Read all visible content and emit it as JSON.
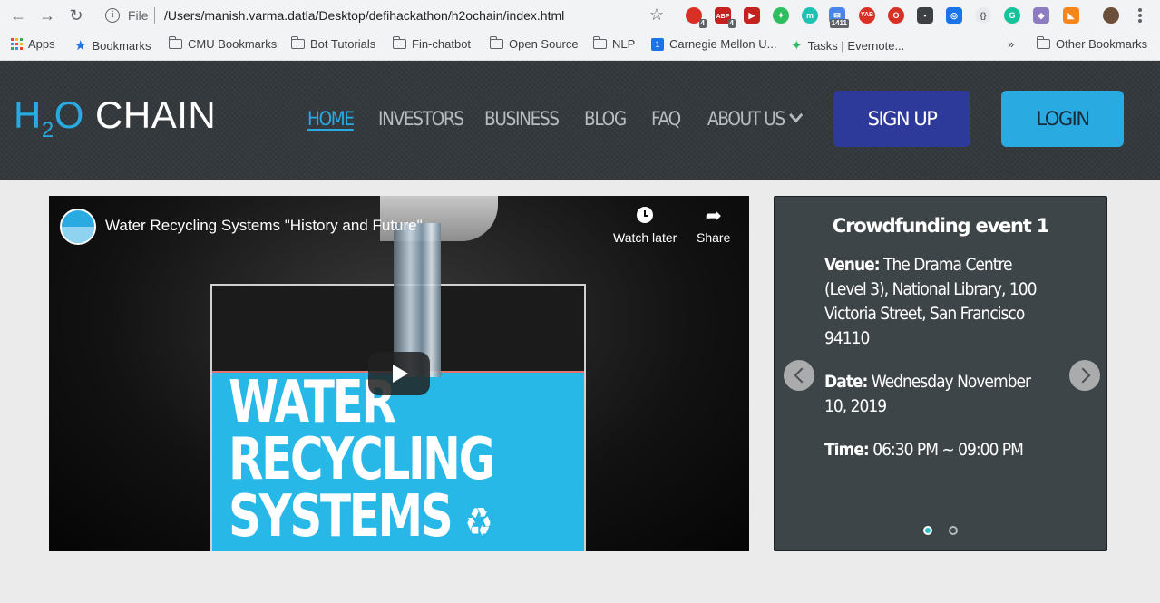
{
  "browser": {
    "address": {
      "scheme_label": "File",
      "url": "/Users/manish.varma.datla/Desktop/defihackathon/h2ochain/index.html"
    },
    "extension_badges": {
      "ext1": "4",
      "ext2": "4",
      "mail": "1411",
      "yab": "YAB",
      "abp": "ABP"
    },
    "bookmarks": [
      {
        "label": "Apps",
        "icon": "apps-grid-icon"
      },
      {
        "label": "Bookmarks",
        "icon": "star-icon"
      },
      {
        "label": "CMU Bookmarks",
        "icon": "folder-icon"
      },
      {
        "label": "Bot Tutorials",
        "icon": "folder-icon"
      },
      {
        "label": "Fin-chatbot",
        "icon": "folder-icon"
      },
      {
        "label": "Open Source",
        "icon": "folder-icon"
      },
      {
        "label": "NLP",
        "icon": "folder-icon"
      },
      {
        "label": "Carnegie Mellon U...",
        "icon": "calendar-icon"
      },
      {
        "label": "Tasks | Evernote...",
        "icon": "evernote-icon"
      }
    ],
    "overflow": "»",
    "other_bookmarks": "Other Bookmarks"
  },
  "site": {
    "logo": {
      "part1": "H",
      "sub": "2",
      "part2": "O",
      "part3": " CHAIN"
    },
    "nav": [
      {
        "label": "HOME",
        "active": true
      },
      {
        "label": "INVESTORS"
      },
      {
        "label": "BUSINESS"
      },
      {
        "label": "BLOG"
      },
      {
        "label": "FAQ"
      },
      {
        "label": "ABOUT US",
        "dropdown": true
      }
    ],
    "signup_label": "SIGN UP",
    "login_label": "LOGIN",
    "colors": {
      "accent": "#29aae1",
      "signup": "#2e3a9a",
      "header": "#34393d"
    }
  },
  "video": {
    "title": "Water Recycling Systems \"History and Future\"",
    "watch_later": "Watch later",
    "share": "Share",
    "thumbnail_lines": [
      "WATER",
      "RECYCLING",
      "SYSTEMS"
    ]
  },
  "carousel": {
    "event_title": "Crowdfunding event 1",
    "venue_label": "Venue:",
    "venue": "The Drama Centre (Level 3), National Library, 100 Victoria Street, San Francisco 94110",
    "date_label": "Date:",
    "date": "Wednesday November 10, 2019",
    "time_label": "Time:",
    "time": "06:30 PM ~ 09:00 PM",
    "slides": 2,
    "active_slide": 1
  }
}
